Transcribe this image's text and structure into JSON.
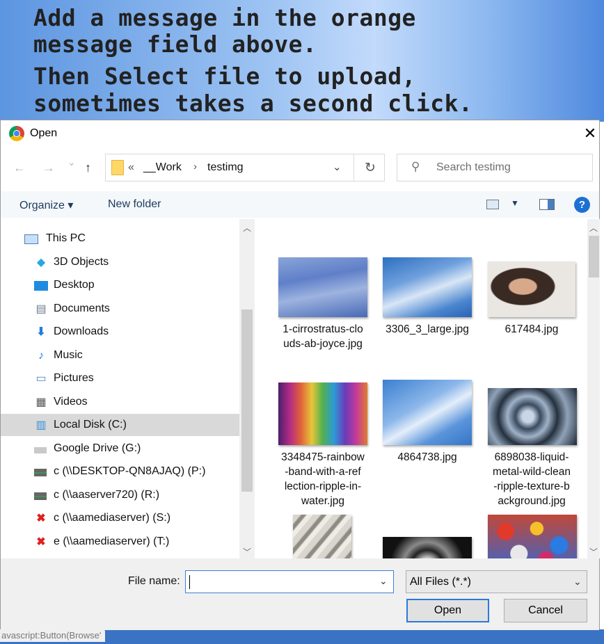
{
  "background": {
    "banner_lines": [
      "Add a message in the orange",
      "message field above.",
      "Then Select file to upload,",
      "sometimes takes a second click."
    ],
    "status_text": "avascript:Button(Browse'"
  },
  "dialog": {
    "title": "Open",
    "close_glyph": "✕",
    "nav": {
      "back": "←",
      "forward": "→",
      "recent": "⌄",
      "up": "↑"
    },
    "address": {
      "overflow": "«",
      "crumbs": [
        "__Work",
        "testimg"
      ],
      "sep": "›",
      "dropdown": "⌄",
      "refresh": "↻"
    },
    "search": {
      "placeholder": "Search testimg",
      "icon": "⚲"
    },
    "toolbar": {
      "organize": "Organize ▾",
      "new_folder": "New folder",
      "help": "?"
    },
    "nav_items": [
      {
        "label": "This PC",
        "icon": "computer-icon",
        "level": 0
      },
      {
        "label": "3D Objects",
        "icon": "cube-icon",
        "level": 1
      },
      {
        "label": "Desktop",
        "icon": "desktop-icon",
        "level": 1
      },
      {
        "label": "Documents",
        "icon": "document-icon",
        "level": 1
      },
      {
        "label": "Downloads",
        "icon": "download-icon",
        "level": 1
      },
      {
        "label": "Music",
        "icon": "music-icon",
        "level": 1
      },
      {
        "label": "Pictures",
        "icon": "pictures-icon",
        "level": 1
      },
      {
        "label": "Videos",
        "icon": "video-icon",
        "level": 1
      },
      {
        "label": "Local Disk (C:)",
        "icon": "disk-icon",
        "level": 1,
        "selected": true
      },
      {
        "label": "Google Drive (G:)",
        "icon": "drive-icon",
        "level": 1
      },
      {
        "label": "c (\\\\DESKTOP-QN8AJAQ) (P:)",
        "icon": "network-drive-icon",
        "level": 1
      },
      {
        "label": "c (\\\\aaserver720) (R:)",
        "icon": "network-drive-icon",
        "level": 1
      },
      {
        "label": "c (\\\\aamediaserver) (S:)",
        "icon": "disconnected-drive-icon",
        "level": 1
      },
      {
        "label": "e (\\\\aamediaserver) (T:)",
        "icon": "disconnected-drive-icon",
        "level": 1
      }
    ],
    "files": [
      {
        "name_lines": [
          "1-cirrostratus-clo",
          "uds-ab-joyce.jpg"
        ]
      },
      {
        "name_lines": [
          "3306_3_large.jpg"
        ]
      },
      {
        "name_lines": [
          "617484.jpg"
        ]
      },
      {
        "name_lines": [
          "3348475-rainbow",
          "-band-with-a-ref",
          "lection-ripple-in-",
          "water.jpg"
        ]
      },
      {
        "name_lines": [
          "4864738.jpg"
        ]
      },
      {
        "name_lines": [
          "6898038-liquid-",
          "metal-wild-clean",
          "-ripple-texture-b",
          "ackground.jpg"
        ]
      }
    ],
    "filename_label": "File name:",
    "filename_value": "",
    "filetype": "All Files (*.*)",
    "open_button": "Open",
    "cancel_button": "Cancel",
    "dropdown_glyph": "⌄",
    "scroll_up": "︿",
    "scroll_down": "﹀"
  }
}
